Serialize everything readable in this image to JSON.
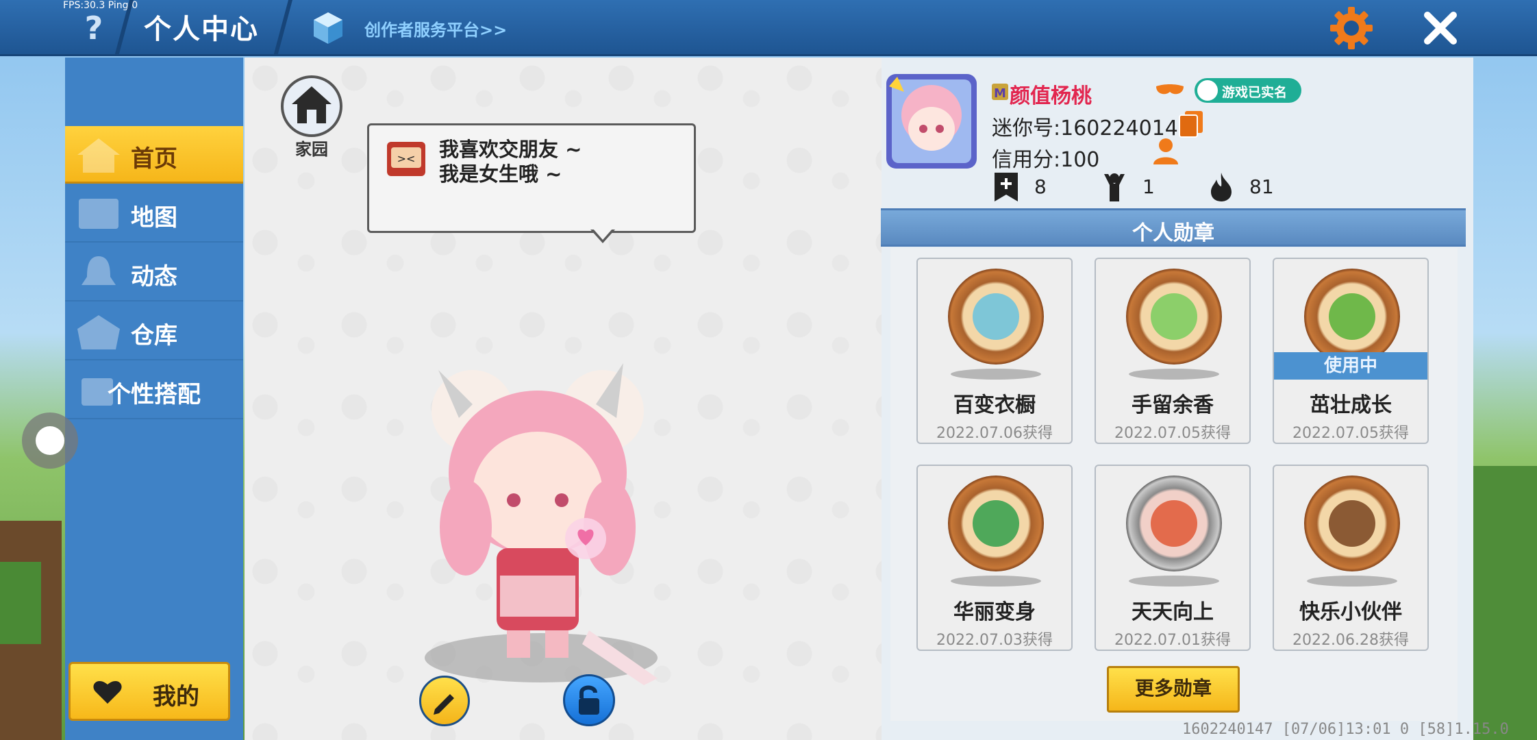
{
  "debug": {
    "fps_text": "FPS:30.3  Ping:0"
  },
  "header": {
    "help_label": "?",
    "title": "个人中心",
    "creator_link": "创作者服务平台>>"
  },
  "sidebar": {
    "items": [
      {
        "label": "首页",
        "active": true
      },
      {
        "label": "地图",
        "active": false
      },
      {
        "label": "动态",
        "active": false
      },
      {
        "label": "仓库",
        "active": false
      },
      {
        "label": "个性搭配",
        "active": false
      }
    ],
    "mine_label": "我的"
  },
  "home": {
    "label": "家园"
  },
  "bubble": {
    "line1": "我喜欢交朋友 ~",
    "line2": "我是女生哦 ~"
  },
  "profile": {
    "nickname": "颜值杨桃",
    "verified": "游戏已实名",
    "mini_id": "迷你号:1602240147",
    "credit": "信用分:100",
    "stats": [
      {
        "icon": "plus-bookmark-icon",
        "value": "8"
      },
      {
        "icon": "cheer-icon",
        "value": "1"
      },
      {
        "icon": "flame-icon",
        "value": "81"
      }
    ]
  },
  "badges": {
    "header": "个人勋章",
    "in_use_label": "使用中",
    "items": [
      {
        "name": "百变衣橱",
        "date": "2022.07.06获得",
        "medal": "bronze",
        "in_use": false
      },
      {
        "name": "手留余香",
        "date": "2022.07.05获得",
        "medal": "bronze",
        "in_use": false
      },
      {
        "name": "茁壮成长",
        "date": "2022.07.05获得",
        "medal": "bronze",
        "in_use": true
      },
      {
        "name": "华丽变身",
        "date": "2022.07.03获得",
        "medal": "bronze",
        "in_use": false
      },
      {
        "name": "天天向上",
        "date": "2022.07.01获得",
        "medal": "silver",
        "in_use": false
      },
      {
        "name": "快乐小伙伴",
        "date": "2022.06.28获得",
        "medal": "bronze",
        "in_use": false
      }
    ],
    "more_label": "更多勋章"
  },
  "footer": {
    "info": "1602240147   [07/06]13:01 0   [58]1.15.0"
  },
  "colors": {
    "accent_yellow": "#f6b61a",
    "nickname_red": "#e2264f",
    "sidebar_blue": "#3f82c6",
    "verified_green": "#1fae96"
  }
}
